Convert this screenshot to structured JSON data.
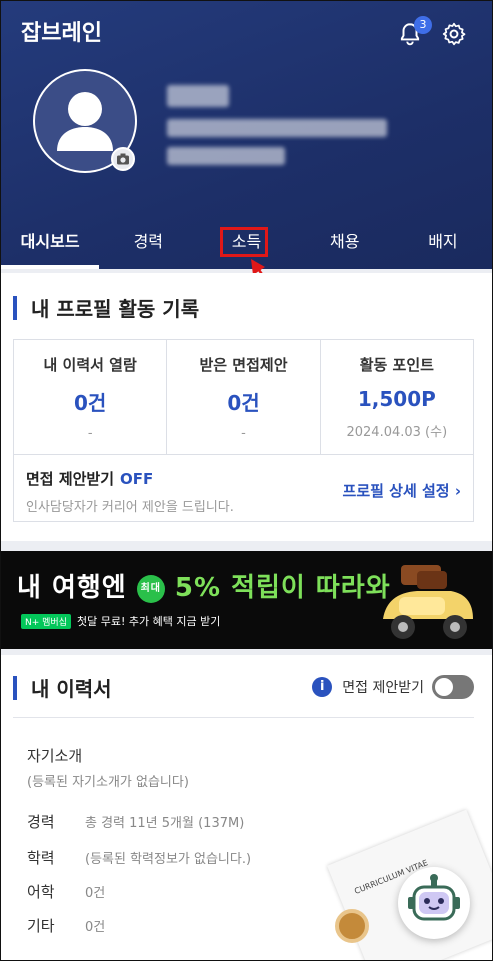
{
  "app": {
    "title": "잡브레인",
    "notification_count": "3"
  },
  "icons": {
    "bell": "bell-icon",
    "settings": "gear-icon",
    "camera": "camera-icon",
    "info": "info-icon",
    "chevron": "chevron-right-icon"
  },
  "tabs": [
    {
      "label": "대시보드",
      "active": true
    },
    {
      "label": "경력",
      "active": false
    },
    {
      "label": "소득",
      "active": false
    },
    {
      "label": "채용",
      "active": false
    },
    {
      "label": "배지",
      "active": false
    }
  ],
  "activity": {
    "title": "내 프로필 활동 기록",
    "stats": [
      {
        "label": "내 이력서 열람",
        "value": "0건",
        "sub": "-"
      },
      {
        "label": "받은 면접제안",
        "value": "0건",
        "sub": "-"
      },
      {
        "label": "활동 포인트",
        "value": "1,500P",
        "sub": "2024.04.03 (수)"
      }
    ],
    "offer_label": "면접 제안받기",
    "offer_state": "OFF",
    "offer_desc": "인사담당자가 커리어 제안을 드립니다.",
    "profile_link": "프로필 상세 설정 ›"
  },
  "banner": {
    "title_a": "내 여행엔",
    "max": "최대",
    "percent": "5%",
    "title_b": "적립이 따라와",
    "npay": "N+ 멤버십",
    "sub": "첫달 무료! 추가 혜택 지금 받기"
  },
  "resume": {
    "title": "내 이력서",
    "toggle_label": "면접 제안받기",
    "intro_title": "자기소개",
    "intro_empty": "(등록된 자기소개가 없습니다)",
    "rows": [
      {
        "label": "경력",
        "value": "총 경력 11년 5개월 (137M)"
      },
      {
        "label": "학력",
        "value": "(등록된 학력정보가 없습니다.)"
      },
      {
        "label": "어학",
        "value": "0건"
      },
      {
        "label": "기타",
        "value": "0건"
      }
    ],
    "doc_text": "CURRICULUM VITAE"
  },
  "colors": {
    "header": "#1d2f68",
    "accent": "#2a52be",
    "highlight": "#e01818"
  }
}
